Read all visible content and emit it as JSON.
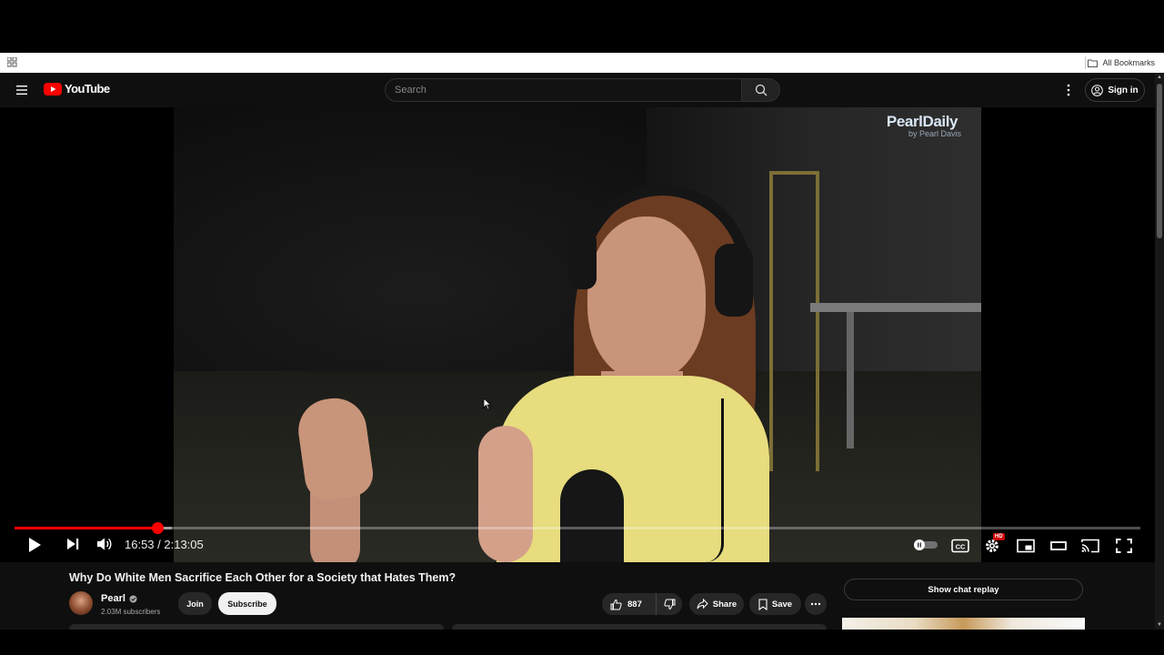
{
  "browser": {
    "bookmarks_label": "All Bookmarks"
  },
  "masthead": {
    "logo_text": "YouTube",
    "search_placeholder": "Search",
    "signin_label": "Sign in"
  },
  "player": {
    "watermark_name": "PearlDaily",
    "watermark_byline": "by Pearl Davis",
    "current_time": "16:53",
    "duration": "2:13:05",
    "time_display": "16:53 / 2:13:05",
    "progress_fraction": 0.1266,
    "buffer_fraction": 0.14,
    "hd_badge": "HD"
  },
  "video": {
    "title": "Why Do White Men Sacrifice Each Other for a Society that Hates Them?"
  },
  "channel": {
    "name": "Pearl",
    "subscribers": "2.03M subscribers",
    "join_label": "Join",
    "subscribe_label": "Subscribe"
  },
  "actions": {
    "like_count": "887",
    "share_label": "Share",
    "save_label": "Save"
  },
  "chat": {
    "show_replay_label": "Show chat replay"
  },
  "colors": {
    "accent": "#ff0000",
    "background": "#0f0f0f"
  }
}
